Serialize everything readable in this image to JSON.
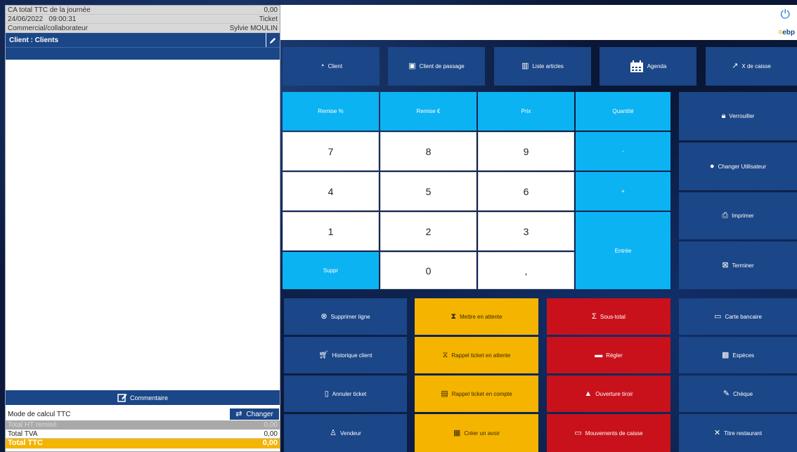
{
  "summary": {
    "ca_label": "CA total TTC de la journée",
    "ca_value": "0,00",
    "date": "24/06/2022",
    "time": "09:00:31",
    "doc_type": "Ticket",
    "commercial_label": "Commercial/collaborateur",
    "commercial_value": "Sylvie MOULIN"
  },
  "client": {
    "label": "Client :",
    "value": "Clients"
  },
  "comment_label": "Commentaire",
  "mode": {
    "label": "Mode de calcul TTC",
    "change_label": "Changer"
  },
  "totals": {
    "ht_label": "Total HT remisé",
    "ht_value": "0,00",
    "tva_label": "Total TVA",
    "tva_value": "0,00",
    "ttc_label": "Total TTC",
    "ttc_value": "0,00"
  },
  "brand": "ebp",
  "top_buttons": [
    "Client",
    "Client de passage",
    "Liste articles",
    "Agenda",
    "X de caisse"
  ],
  "keypad": {
    "headers": [
      "Remise %",
      "Remise €",
      "Prix",
      "Quantité"
    ],
    "minus": "-",
    "plus": "+",
    "enter": "Entrée",
    "delete": "Suppr",
    "digits": [
      "7",
      "8",
      "9",
      "4",
      "5",
      "6",
      "1",
      "2",
      "3",
      "0",
      ","
    ]
  },
  "side_buttons": [
    "Verrouiller",
    "Changer Utilisateur",
    "Imprimer",
    "Terminer"
  ],
  "actions": {
    "col1": [
      "Supprimer ligne",
      "Historique client",
      "Annuler ticket",
      "Vendeur"
    ],
    "col2": [
      "Mettre en attente",
      "Rappel ticket en attente",
      "Rappel ticket en compte",
      "Créer un avoir"
    ],
    "col3": [
      "Sous-total",
      "Régler",
      "Ouverture tiroir",
      "Mouvements de caisse"
    ],
    "col4": [
      "Carte bancaire",
      "Espèces",
      "Chèque",
      "Titre restaurant"
    ]
  },
  "colors": {
    "navy": "#1b4687",
    "cyan": "#0bb3f2",
    "yellow": "#f5b400",
    "red": "#c8111b"
  }
}
